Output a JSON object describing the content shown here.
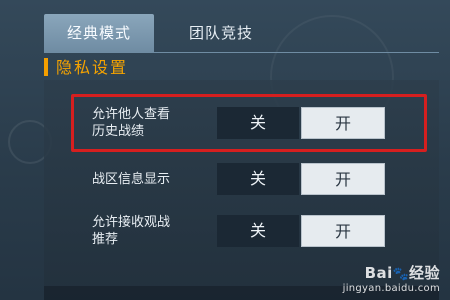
{
  "tabs": [
    {
      "label": "经典模式",
      "active": true
    },
    {
      "label": "团队竞技",
      "active": false
    }
  ],
  "section": {
    "title": "隐私设置"
  },
  "settings": [
    {
      "label_lines": [
        "允许他人查看",
        "历史战绩"
      ],
      "off_label": "关",
      "on_label": "开",
      "selected": "on",
      "highlighted": true
    },
    {
      "label_lines": [
        "战区信息显示"
      ],
      "off_label": "关",
      "on_label": "开",
      "selected": "on",
      "highlighted": false
    },
    {
      "label_lines": [
        "允许接收观战",
        "推荐"
      ],
      "off_label": "关",
      "on_label": "开",
      "selected": "on",
      "highlighted": false
    }
  ],
  "watermark": {
    "brand": "Bai",
    "paw": "🐾",
    "suffix": "经验",
    "url": "jingyan.baidu.com"
  },
  "colors": {
    "accent": "#f5a300",
    "highlight": "#d61f1f",
    "active_tab": "#7f9bb1"
  }
}
